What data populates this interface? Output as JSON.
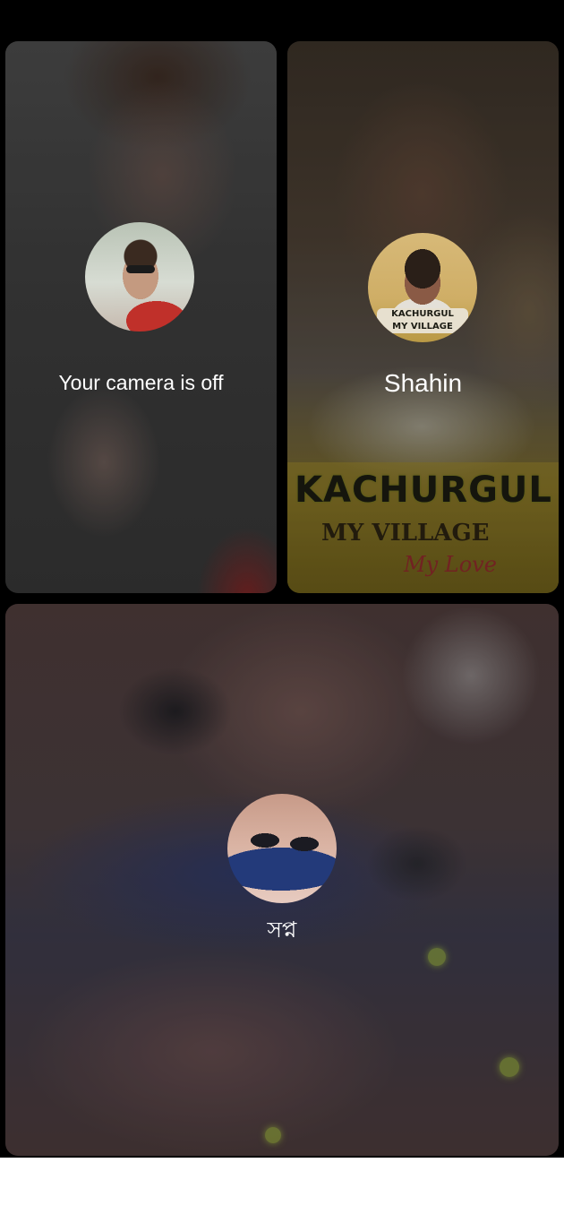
{
  "call": {
    "participants": [
      {
        "id": "self",
        "label": "Your camera is off",
        "avatar_icon": "profile-photo"
      },
      {
        "id": "shahin",
        "label": "Shahin",
        "avatar_icon": "profile-photo",
        "background_banner": {
          "title": "KACHURGUL",
          "line1": "MY VILLAGE",
          "line2": "My Love"
        },
        "avatar_banner": "KACHURGUL\nMY VILLAGE"
      },
      {
        "id": "swapna",
        "label": "সপ্ন",
        "avatar_icon": "profile-photo"
      }
    ]
  },
  "colors": {
    "call_background": "#000000",
    "label_text": "#ffffff",
    "bottom_bar": "#ffffff"
  }
}
